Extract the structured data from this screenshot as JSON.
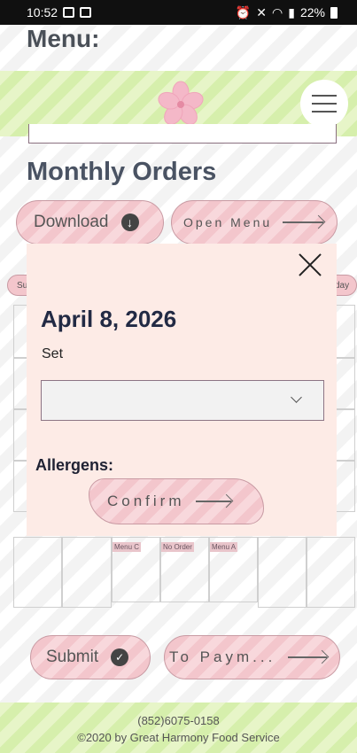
{
  "status_bar": {
    "time": "10:52",
    "battery": "22%"
  },
  "header": {
    "menu_title": "Menu:"
  },
  "section": {
    "title": "Monthly Orders"
  },
  "actions": {
    "download_label": "Download",
    "open_menu_label": "Open Menu"
  },
  "calendar": {
    "left_tag": "Su",
    "right_tag": "day",
    "cells": [
      "Menu C",
      "No Order",
      "Menu A"
    ]
  },
  "modal": {
    "date": "April 8, 2026",
    "set_label": "Set",
    "set_value": "",
    "allergens_label": "Allergens:",
    "confirm_label": "Confirm"
  },
  "bottom_actions": {
    "submit_label": "Submit",
    "to_payment_label": "To Paym..."
  },
  "footer": {
    "phone": "(852)6075-0158",
    "copyright": "©2020 by Great Harmony Food Service"
  },
  "colors": {
    "pink_button": "#f3c6cc",
    "modal_bg": "#fdebe6",
    "green_band": "#d6efac",
    "title_color": "#4a5363"
  },
  "icons": [
    "image-icon",
    "check-box-icon",
    "alarm-icon",
    "mute-icon",
    "wifi-icon",
    "signal-icon",
    "battery-icon",
    "blossom-logo-icon",
    "hamburger-icon",
    "download-icon",
    "arrow-right-icon",
    "close-icon",
    "chevron-down-icon",
    "check-circle-icon"
  ]
}
